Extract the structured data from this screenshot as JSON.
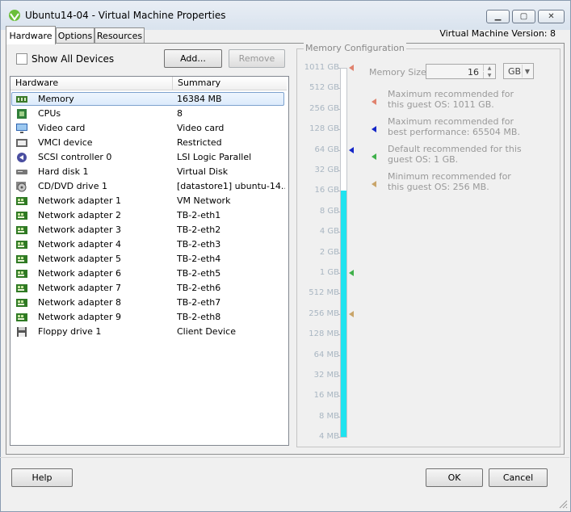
{
  "window": {
    "title": "Ubuntu14-04 - Virtual Machine Properties",
    "vm_version": "Virtual Machine Version: 8"
  },
  "tabs": [
    {
      "label": "Hardware",
      "active": true
    },
    {
      "label": "Options",
      "active": false
    },
    {
      "label": "Resources",
      "active": false
    }
  ],
  "toolbar": {
    "show_all_devices": "Show All Devices",
    "add_label": "Add...",
    "remove_label": "Remove"
  },
  "hardware": {
    "col_hardware": "Hardware",
    "col_summary": "Summary",
    "rows": [
      {
        "name": "Memory",
        "summary": "16384 MB",
        "icon": "memory-icon"
      },
      {
        "name": "CPUs",
        "summary": "8",
        "icon": "cpu-icon"
      },
      {
        "name": "Video card",
        "summary": "Video card",
        "icon": "monitor-icon"
      },
      {
        "name": "VMCI device",
        "summary": "Restricted",
        "icon": "vmci-icon"
      },
      {
        "name": "SCSI controller 0",
        "summary": "LSI Logic Parallel",
        "icon": "scsi-icon"
      },
      {
        "name": "Hard disk 1",
        "summary": "Virtual Disk",
        "icon": "harddisk-icon"
      },
      {
        "name": "CD/DVD drive 1",
        "summary": "[datastore1] ubuntu-14...",
        "icon": "cdrom-icon"
      },
      {
        "name": "Network adapter 1",
        "summary": "VM Network",
        "icon": "network-adapter-icon"
      },
      {
        "name": "Network adapter 2",
        "summary": "TB-2-eth1",
        "icon": "network-adapter-icon"
      },
      {
        "name": "Network adapter 3",
        "summary": "TB-2-eth2",
        "icon": "network-adapter-icon"
      },
      {
        "name": "Network adapter 4",
        "summary": "TB-2-eth3",
        "icon": "network-adapter-icon"
      },
      {
        "name": "Network adapter 5",
        "summary": "TB-2-eth4",
        "icon": "network-adapter-icon"
      },
      {
        "name": "Network adapter 6",
        "summary": "TB-2-eth5",
        "icon": "network-adapter-icon"
      },
      {
        "name": "Network adapter 7",
        "summary": "TB-2-eth6",
        "icon": "network-adapter-icon"
      },
      {
        "name": "Network adapter 8",
        "summary": "TB-2-eth7",
        "icon": "network-adapter-icon"
      },
      {
        "name": "Network adapter 9",
        "summary": "TB-2-eth8",
        "icon": "network-adapter-icon"
      },
      {
        "name": "Floppy drive 1",
        "summary": "Client Device",
        "icon": "floppy-icon"
      }
    ]
  },
  "memory": {
    "group_title": "Memory Configuration",
    "size_label": "Memory Size:",
    "size_value": "16",
    "unit": "GB",
    "scale": [
      "1011 GB",
      "512 GB",
      "256 GB",
      "128 GB",
      "64 GB",
      "32 GB",
      "16 GB",
      "8 GB",
      "4 GB",
      "2 GB",
      "1 GB",
      "512 MB",
      "256 MB",
      "128 MB",
      "64 MB",
      "32 MB",
      "16 MB",
      "8 MB",
      "4 MB"
    ],
    "current_level_index": 6,
    "markers": [
      {
        "label": "Maximum recommended for this guest OS: 1011 GB.",
        "color": "#e0826e",
        "scale_index": 0
      },
      {
        "label": "Maximum recommended for best performance: 65504 MB.",
        "color": "#1426c8",
        "scale_index": 4
      },
      {
        "label": "Default recommended for this guest OS: 1 GB.",
        "color": "#3fb04a",
        "scale_index": 10
      },
      {
        "label": "Minimum recommended for this guest OS: 256 MB.",
        "color": "#c9a56a",
        "scale_index": 12
      }
    ]
  },
  "footer": {
    "help_label": "Help",
    "ok_label": "OK",
    "cancel_label": "Cancel"
  }
}
